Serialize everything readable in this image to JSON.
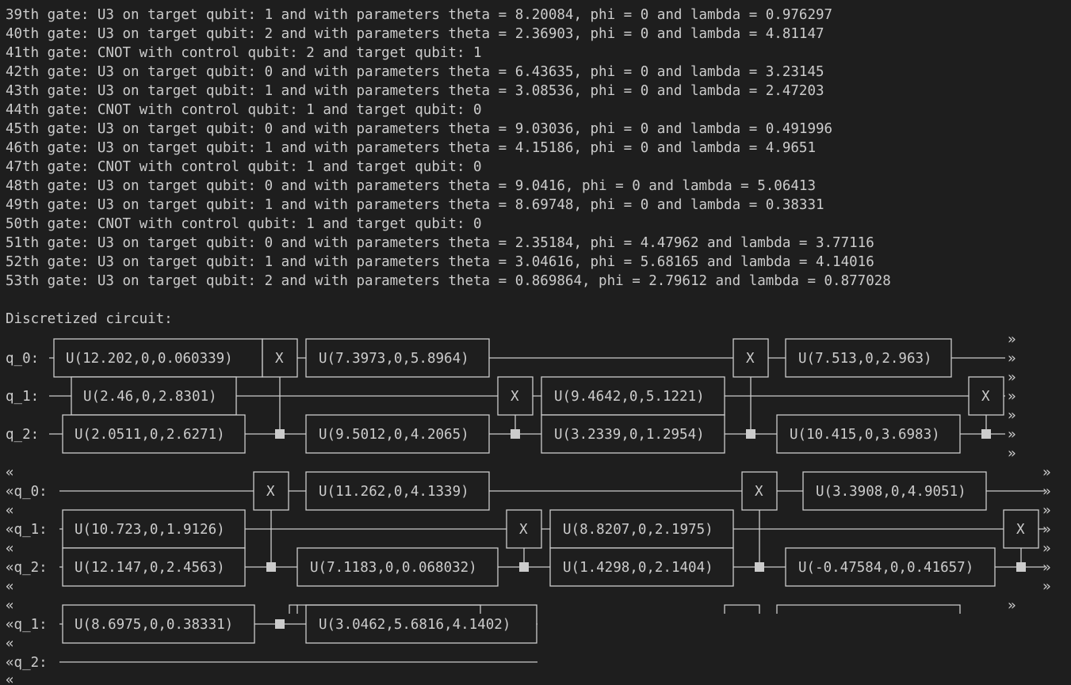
{
  "log_lines": [
    "39th gate: U3 on target qubit: 1 and with parameters theta = 8.20084, phi = 0 and lambda = 0.976297",
    "40th gate: U3 on target qubit: 2 and with parameters theta = 2.36903, phi = 0 and lambda = 4.81147",
    "41th gate: CNOT with control qubit: 2 and target qubit: 1",
    "42th gate: U3 on target qubit: 0 and with parameters theta = 6.43635, phi = 0 and lambda = 3.23145",
    "43th gate: U3 on target qubit: 1 and with parameters theta = 3.08536, phi = 0 and lambda = 2.47203",
    "44th gate: CNOT with control qubit: 1 and target qubit: 0",
    "45th gate: U3 on target qubit: 0 and with parameters theta = 9.03036, phi = 0 and lambda = 0.491996",
    "46th gate: U3 on target qubit: 1 and with parameters theta = 4.15186, phi = 0 and lambda = 4.9651",
    "47th gate: CNOT with control qubit: 1 and target qubit: 0",
    "48th gate: U3 on target qubit: 0 and with parameters theta = 9.0416, phi = 0 and lambda = 5.06413",
    "49th gate: U3 on target qubit: 1 and with parameters theta = 8.69748, phi = 0 and lambda = 0.38331",
    "50th gate: CNOT with control qubit: 1 and target qubit: 0",
    "51th gate: U3 on target qubit: 0 and with parameters theta = 2.35184, phi = 4.47962 and lambda = 3.77116",
    "52th gate: U3 on target qubit: 1 and with parameters theta = 3.04616, phi = 5.68165 and lambda = 4.14016",
    "53th gate: U3 on target qubit: 2 and with parameters theta = 0.869864, phi = 2.79612 and lambda = 0.877028"
  ],
  "circuit_heading": "Discretized circuit:",
  "continuation_marker": "«",
  "continuation_marker_right": "»",
  "target_symbol": "X",
  "block1": {
    "labels": [
      "q_0:",
      "q_1:",
      "q_2:"
    ],
    "gates": [
      "U(12.202,0,0.060339)",
      "U(2.46,0,2.8301)",
      "U(2.0511,0,2.6271)",
      "U(7.3973,0,5.8964)",
      "U(9.5012,0,4.2065)",
      "U(9.4642,0,5.1221)",
      "U(3.2339,0,1.2954)",
      "U(7.513,0,2.963)",
      "U(10.415,0,3.6983)"
    ]
  },
  "block2": {
    "labels": [
      "«q_0:",
      "«q_1:",
      "«q_2:"
    ],
    "gates": [
      "U(10.723,0,1.9126)",
      "U(12.147,0,2.4563)",
      "U(11.262,0,4.1339)",
      "U(7.1183,0,0.068032)",
      "U(8.8207,0,2.1975)",
      "U(1.4298,0,2.1404)",
      "U(3.3908,0,4.9051)",
      "U(-0.47584,0,0.41657)"
    ]
  },
  "block3": {
    "labels": [
      "«q_1:",
      "«q_2:"
    ],
    "gates": [
      "U(8.6975,0,0.38331)",
      "U(3.0462,5.6816,4.1402)"
    ]
  }
}
